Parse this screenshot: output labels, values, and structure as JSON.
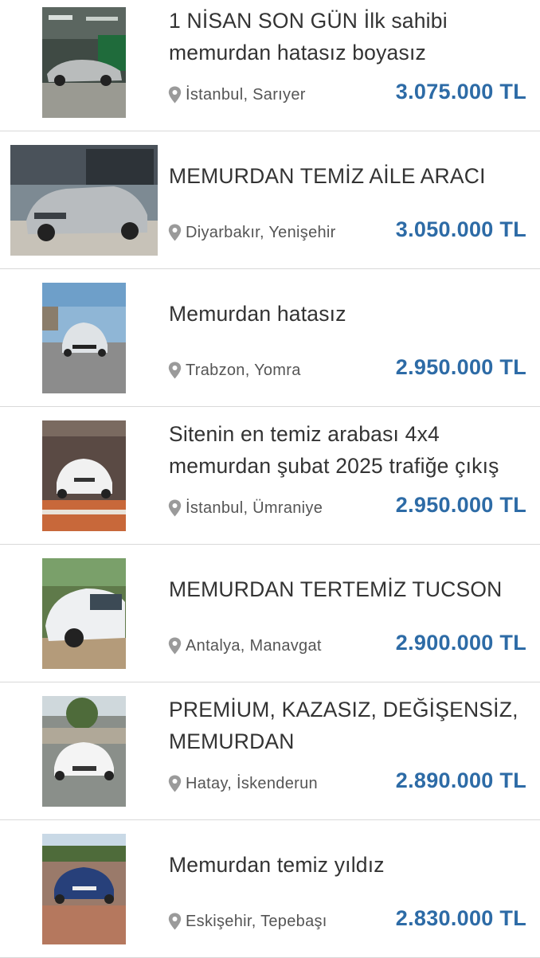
{
  "listings": [
    {
      "title": "1 NİSAN SON GÜN İlk sahibi memurdan hatasız boyasız",
      "location": "İstanbul, Sarıyer",
      "price": "3.075.000 TL"
    },
    {
      "title": "MEMURDAN TEMİZ AİLE ARACI",
      "location": "Diyarbakır, Yenişehir",
      "price": "3.050.000 TL"
    },
    {
      "title": "Memurdan hatasız",
      "location": "Trabzon, Yomra",
      "price": "2.950.000 TL"
    },
    {
      "title": "Sitenin en temiz arabası 4x4 memurdan şubat 2025 trafiğe çıkış",
      "location": "İstanbul, Ümraniye",
      "price": "2.950.000 TL"
    },
    {
      "title": "MEMURDAN TERTEMİZ TUCSON",
      "location": "Antalya, Manavgat",
      "price": "2.900.000 TL"
    },
    {
      "title": "PREMİUM, KAZASIZ, DEĞİŞENSİZ, MEMURDAN",
      "location": "Hatay, İskenderun",
      "price": "2.890.000 TL"
    },
    {
      "title": "Memurdan temiz yıldız",
      "location": "Eskişehir, Tepebaşı",
      "price": "2.830.000 TL"
    }
  ],
  "colors": {
    "price": "#2d6ba6",
    "title": "#333333",
    "location": "#555555",
    "divider": "#d9d9d9",
    "pin": "#9a9a9a"
  },
  "icons": {
    "location": "map-pin-icon"
  }
}
